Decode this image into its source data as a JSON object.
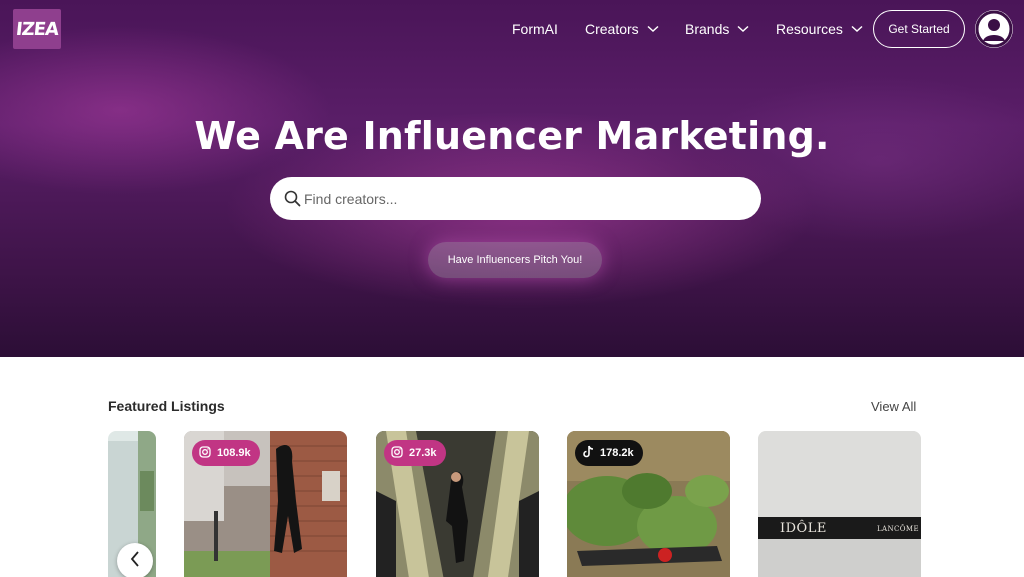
{
  "header": {
    "logo_text": "IZEA",
    "nav": [
      {
        "label": "FormAI",
        "has_dropdown": false
      },
      {
        "label": "Creators",
        "has_dropdown": true
      },
      {
        "label": "Brands",
        "has_dropdown": true
      },
      {
        "label": "Resources",
        "has_dropdown": true
      }
    ],
    "cta_label": "Get Started",
    "avatar_icon": "user-avatar-icon"
  },
  "hero": {
    "headline": "We Are Influencer Marketing.",
    "search": {
      "placeholder": "Find creators...",
      "value": ""
    },
    "pitch_label": "Have Influencers Pitch You!"
  },
  "featured": {
    "title": "Featured Listings",
    "view_all_label": "View All",
    "listings": [
      {
        "platform": "instagram",
        "followers": "108.9k"
      },
      {
        "platform": "instagram",
        "followers": "27.3k"
      },
      {
        "platform": "tiktok",
        "followers": "178.2k"
      },
      {
        "platform": "none",
        "followers": "",
        "product_text": "IDÔLE",
        "brand_text": "LANCÔME"
      }
    ]
  },
  "colors": {
    "hero_top": "#4a1558",
    "hero_glow": "#be46aa",
    "instagram_badge": "#c13584",
    "tiktok_badge": "#111111",
    "logo_bg": "#8f3f8e"
  }
}
